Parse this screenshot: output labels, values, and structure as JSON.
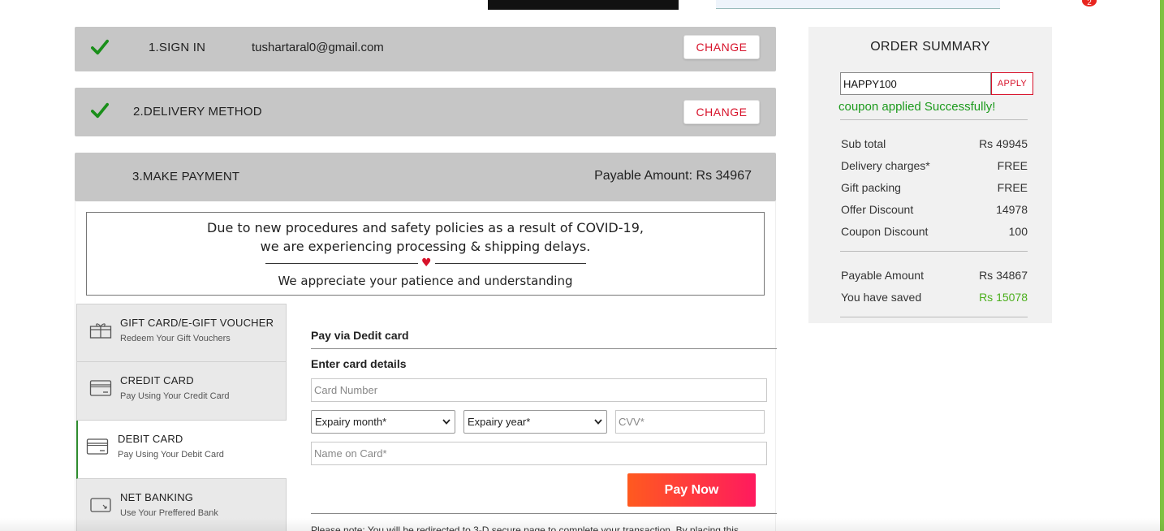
{
  "header": {
    "cart_count": "2"
  },
  "steps": {
    "signin": {
      "label": "1.SIGN IN",
      "email": "tushartaral0@gmail.com",
      "change_label": "CHANGE"
    },
    "delivery": {
      "label": "2.DELIVERY METHOD",
      "change_label": "CHANGE"
    },
    "payment": {
      "label": "3.MAKE PAYMENT",
      "payable": "Payable Amount: Rs 34967"
    }
  },
  "covid_notice": {
    "line1": "Due to new procedures and safety policies as a result of COVID-19,",
    "line2": "we are experiencing processing & shipping delays.",
    "line3": "We appreciate your patience and understanding"
  },
  "payment_tabs": [
    {
      "title": "GIFT CARD/E-GIFT VOUCHER",
      "sub": "Redeem Your Gift Vouchers",
      "icon": "gift-icon"
    },
    {
      "title": "CREDIT CARD",
      "sub": "Pay Using Your Credit Card",
      "icon": "credit-card-icon"
    },
    {
      "title": "DEBIT CARD",
      "sub": "Pay Using Your Debit Card",
      "icon": "debit-card-icon",
      "active": true
    },
    {
      "title": "NET BANKING",
      "sub": "Use Your Preffered Bank",
      "icon": "bank-icon"
    }
  ],
  "card_form": {
    "title": "Pay via Dedit card",
    "subtitle": "Enter card details",
    "card_number_placeholder": "Card Number",
    "month_selected": "Expairy month*",
    "year_selected": "Expairy year*",
    "cvv_placeholder": "CVV*",
    "name_placeholder": "Name on Card*",
    "pay_label": "Pay Now",
    "note": "Please note: You will be redirected to 3-D secure page to complete your transaction. By placing this"
  },
  "summary": {
    "title": "ORDER SUMMARY",
    "coupon_value": "HAPPY100",
    "apply_label": "APPLY",
    "coupon_message": "coupon applied Successfully!",
    "rows": [
      {
        "label": "Sub total",
        "value": "Rs 49945"
      },
      {
        "label": "Delivery charges*",
        "value": "FREE"
      },
      {
        "label": "Gift packing",
        "value": "FREE"
      },
      {
        "label": "Offer Discount",
        "value": "14978"
      },
      {
        "label": "Coupon Discount",
        "value": "100"
      }
    ],
    "payable_label": "Payable Amount",
    "payable_value": "Rs 34867",
    "saved_label": "You have saved",
    "saved_value": "Rs 15078"
  },
  "colors": {
    "accent_red": "#d7122a",
    "success_green": "#1c9a1c",
    "saved_green": "#4caf1d",
    "step_bg": "#c6c6c6"
  }
}
